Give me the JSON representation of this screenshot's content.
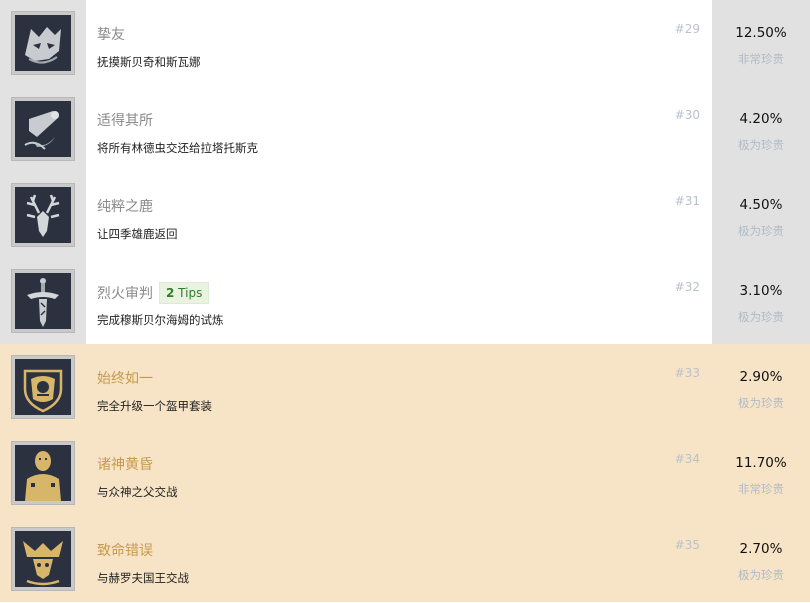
{
  "achievements": [
    {
      "title": "挚友",
      "description": "抚摸斯贝奇和斯瓦娜",
      "number": "#29",
      "percent": "12.50%",
      "rarity": "非常珍贵",
      "tier": "silver",
      "icon": "wolf-icon",
      "tips": ""
    },
    {
      "title": "适得其所",
      "description": "将所有林德虫交还给拉塔托斯克",
      "number": "#30",
      "percent": "4.20%",
      "rarity": "极为珍贵",
      "tier": "silver",
      "icon": "scroll-icon",
      "tips": ""
    },
    {
      "title": "纯粹之鹿",
      "description": "让四季雄鹿返回",
      "number": "#31",
      "percent": "4.50%",
      "rarity": "极为珍贵",
      "tier": "silver",
      "icon": "stag-icon",
      "tips": ""
    },
    {
      "title": "烈火审判",
      "description": "完成穆斯贝尔海姆的试炼",
      "number": "#32",
      "percent": "3.10%",
      "rarity": "极为珍贵",
      "tier": "silver",
      "icon": "sword-icon",
      "tips": "2 Tips"
    },
    {
      "title": "始终如一",
      "description": "完全升级一个盔甲套装",
      "number": "#33",
      "percent": "2.90%",
      "rarity": "极为珍贵",
      "tier": "gold",
      "icon": "armor-crest-icon",
      "tips": ""
    },
    {
      "title": "诸神黄昏",
      "description": "与众神之父交战",
      "number": "#34",
      "percent": "11.70%",
      "rarity": "非常珍贵",
      "tier": "gold",
      "icon": "god-figure-icon",
      "tips": ""
    },
    {
      "title": "致命错误",
      "description": "与赫罗夫国王交战",
      "number": "#35",
      "percent": "2.70%",
      "rarity": "极为珍贵",
      "tier": "gold",
      "icon": "king-crest-icon",
      "tips": ""
    }
  ],
  "colors": {
    "gold_bg": "#f7e4c6",
    "silver_col": "#e1e1e1",
    "gold_title": "#c69a4e",
    "tips_green": "#2e7d2e"
  }
}
